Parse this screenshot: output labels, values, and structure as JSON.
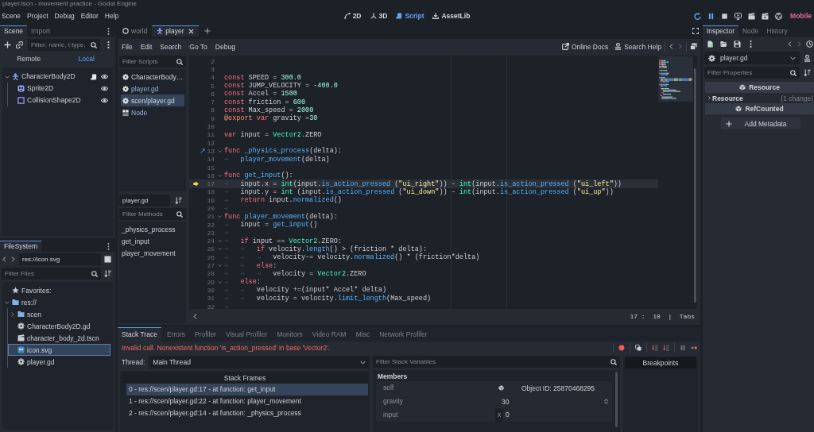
{
  "window": {
    "title": "player.tscn - movement practice - Godot Engine"
  },
  "menu": [
    "Scene",
    "Project",
    "Debug",
    "Editor",
    "Help"
  ],
  "workspaces": [
    {
      "label": "2D",
      "kind": "canvas",
      "selected": false
    },
    {
      "label": "3D",
      "kind": "spatial",
      "selected": false
    },
    {
      "label": "Script",
      "kind": "script",
      "selected": true
    },
    {
      "label": "AssetLib",
      "kind": "assetlib",
      "selected": false
    }
  ],
  "run_buttons": [
    {
      "kind": "restart",
      "active": true
    },
    {
      "kind": "pause",
      "active": true
    },
    {
      "kind": "stop",
      "active": false
    },
    {
      "kind": "remote",
      "active": false
    },
    {
      "kind": "playscene",
      "active": false
    },
    {
      "kind": "playcustom",
      "active": false
    },
    {
      "kind": "movie",
      "active": false
    }
  ],
  "renderer": "Mobile",
  "scene_dock": {
    "tabs": [
      {
        "label": "Scene",
        "selected": true
      },
      {
        "label": "Import",
        "selected": false
      }
    ],
    "filter": {
      "placeholder": "Filter: name, t:type,"
    },
    "modes": [
      {
        "label": "Remote",
        "selected": false
      },
      {
        "label": "Local",
        "selected": true
      }
    ],
    "tree": [
      {
        "name": "CharacterBody2D",
        "kind": "body",
        "expanded": true,
        "script": true,
        "visible": true,
        "children": [
          {
            "name": "Sprite2D",
            "kind": "sprite",
            "script": false,
            "visible": true
          },
          {
            "name": "CollisionShape2D",
            "kind": "shape",
            "script": false,
            "visible": true
          }
        ]
      }
    ]
  },
  "filesystem": {
    "tab": "FileSystem",
    "path": "res://icon.svg",
    "filter": {
      "placeholder": "Filter Files"
    },
    "tree": [
      {
        "name": "Favorites:",
        "kind": "favorites",
        "selected": false
      },
      {
        "name": "res://",
        "kind": "folder",
        "expanded": true,
        "selected": false,
        "children": [
          {
            "name": "scen",
            "kind": "folder",
            "expanded": false,
            "selected": false
          },
          {
            "name": "CharacterBody2D.gd",
            "kind": "script",
            "selected": false
          },
          {
            "name": "character_body_2d.tscn",
            "kind": "scene",
            "selected": false
          },
          {
            "name": "icon.svg",
            "kind": "image",
            "selected": true
          },
          {
            "name": "player.gd",
            "kind": "script",
            "selected": false
          }
        ]
      }
    ]
  },
  "scene_tabs": [
    {
      "label": "world",
      "kind": "node",
      "selected": false,
      "closable": false
    },
    {
      "label": "player",
      "kind": "body",
      "selected": true,
      "closable": true
    }
  ],
  "script_editor": {
    "menu": [
      "File",
      "Edit",
      "Search",
      "Go To",
      "Debug"
    ],
    "links": [
      {
        "label": "Online Docs",
        "kind": "docs"
      },
      {
        "label": "Search Help",
        "kind": "help"
      }
    ],
    "scripts_filter": {
      "placeholder": "Filter Scripts"
    },
    "scripts": [
      {
        "name": "CharacterBody…",
        "kind": "script",
        "highlighted": false,
        "selected": false
      },
      {
        "name": "player.gd",
        "kind": "script",
        "highlighted": true,
        "selected": false
      },
      {
        "name": "scen/player.gd",
        "kind": "script",
        "highlighted": false,
        "selected": true
      },
      {
        "name": "Node",
        "kind": "doc",
        "highlighted": true,
        "selected": false
      }
    ],
    "current_script": "player.gd",
    "methods_filter": {
      "placeholder": "Filter Methods"
    },
    "methods": [
      {
        "name": "_physics_process",
        "selected": false
      },
      {
        "name": "get_input",
        "selected": false
      },
      {
        "name": "player_movement",
        "selected": false
      }
    ],
    "code": [
      {
        "number": "2",
        "foldable": false,
        "current": false,
        "overrides": false
      },
      {
        "number": "3",
        "foldable": false,
        "current": false,
        "overrides": false
      },
      {
        "number": "4",
        "foldable": false,
        "current": false,
        "overrides": false,
        "tokens": [
          {
            "kind": "keyword",
            "text": "const"
          },
          {
            "kind": "plain",
            "text": " SPEED = "
          },
          {
            "kind": "number",
            "text": "300.0"
          }
        ]
      },
      {
        "number": "5",
        "foldable": false,
        "current": false,
        "overrides": false,
        "tokens": [
          {
            "kind": "keyword",
            "text": "const"
          },
          {
            "kind": "plain",
            "text": " JUMP_VELOCITY = "
          },
          {
            "kind": "number",
            "text": "-400.0"
          }
        ]
      },
      {
        "number": "6",
        "foldable": false,
        "current": false,
        "overrides": false,
        "tokens": [
          {
            "kind": "keyword",
            "text": "const"
          },
          {
            "kind": "plain",
            "text": " Accel = "
          },
          {
            "kind": "number",
            "text": "1500"
          }
        ]
      },
      {
        "number": "7",
        "foldable": false,
        "current": false,
        "overrides": false,
        "tokens": [
          {
            "kind": "keyword",
            "text": "const"
          },
          {
            "kind": "plain",
            "text": " friction = "
          },
          {
            "kind": "number",
            "text": "600"
          }
        ]
      },
      {
        "number": "8",
        "foldable": false,
        "current": false,
        "overrides": false,
        "tokens": [
          {
            "kind": "keyword",
            "text": "const"
          },
          {
            "kind": "plain",
            "text": " Max_speed = "
          },
          {
            "kind": "number",
            "text": "2000"
          }
        ]
      },
      {
        "number": "9",
        "foldable": false,
        "current": false,
        "overrides": false,
        "tokens": [
          {
            "kind": "annotation",
            "text": "@export"
          },
          {
            "kind": "keyword",
            "text": " var"
          },
          {
            "kind": "plain",
            "text": " gravity ="
          },
          {
            "kind": "number",
            "text": "30"
          }
        ]
      },
      {
        "number": "10",
        "foldable": false,
        "current": false,
        "overrides": false
      },
      {
        "number": "11",
        "foldable": false,
        "current": false,
        "overrides": false,
        "tokens": [
          {
            "kind": "keyword",
            "text": "var"
          },
          {
            "kind": "plain",
            "text": " input = "
          },
          {
            "kind": "type",
            "text": "Vector2"
          },
          {
            "kind": "plain",
            "text": ".ZERO"
          }
        ]
      },
      {
        "number": "12",
        "foldable": false,
        "current": false,
        "overrides": false
      },
      {
        "number": "13",
        "foldable": true,
        "current": false,
        "overrides": true,
        "tokens": [
          {
            "kind": "keyword",
            "text": "func"
          },
          {
            "kind": "function",
            "text": " _physics_process"
          },
          {
            "kind": "plain",
            "text": "(delta):"
          }
        ]
      },
      {
        "number": "14",
        "foldable": false,
        "current": false,
        "overrides": false,
        "tokens": [
          {
            "kind": "tab"
          },
          {
            "kind": "function",
            "text": "player_movement"
          },
          {
            "kind": "plain",
            "text": "(delta)"
          }
        ]
      },
      {
        "number": "15",
        "foldable": false,
        "current": false,
        "overrides": false
      },
      {
        "number": "16",
        "foldable": true,
        "current": false,
        "overrides": false,
        "tokens": [
          {
            "kind": "keyword",
            "text": "func"
          },
          {
            "kind": "function",
            "text": " get_input"
          },
          {
            "kind": "plain",
            "text": "():"
          }
        ]
      },
      {
        "number": "17",
        "foldable": false,
        "current": true,
        "overrides": false,
        "tokens": [
          {
            "kind": "tab"
          },
          {
            "kind": "plain",
            "text": "input.x = "
          },
          {
            "kind": "type",
            "text": "int"
          },
          {
            "kind": "plain",
            "text": "(input."
          },
          {
            "kind": "function",
            "text": "is_action_pressed"
          },
          {
            "kind": "plain",
            "text": " ("
          },
          {
            "kind": "string",
            "text": "\"ui_right\""
          },
          {
            "kind": "plain",
            "text": ")) - "
          },
          {
            "kind": "type",
            "text": "int"
          },
          {
            "kind": "plain",
            "text": "(input."
          },
          {
            "kind": "function",
            "text": "is_action_pressed"
          },
          {
            "kind": "plain",
            "text": " ("
          },
          {
            "kind": "string",
            "text": "\"ui_left\""
          },
          {
            "kind": "plain",
            "text": "))"
          }
        ]
      },
      {
        "number": "18",
        "foldable": false,
        "current": false,
        "overrides": false,
        "tokens": [
          {
            "kind": "tab"
          },
          {
            "kind": "plain",
            "text": "input.y = "
          },
          {
            "kind": "type",
            "text": "int"
          },
          {
            "kind": "plain",
            "text": " (input."
          },
          {
            "kind": "function",
            "text": "is_action_pressed"
          },
          {
            "kind": "plain",
            "text": " ("
          },
          {
            "kind": "string",
            "text": "\"ui_down\""
          },
          {
            "kind": "plain",
            "text": ")) - "
          },
          {
            "kind": "type",
            "text": "int"
          },
          {
            "kind": "plain",
            "text": "(input."
          },
          {
            "kind": "function",
            "text": "is_action_pressed"
          },
          {
            "kind": "plain",
            "text": " ("
          },
          {
            "kind": "string",
            "text": "\"ui_up\""
          },
          {
            "kind": "plain",
            "text": "))"
          }
        ]
      },
      {
        "number": "19",
        "foldable": false,
        "current": false,
        "overrides": false,
        "tokens": [
          {
            "kind": "tab"
          },
          {
            "kind": "keyword",
            "text": "return"
          },
          {
            "kind": "plain",
            "text": " input."
          },
          {
            "kind": "function",
            "text": "normalized"
          },
          {
            "kind": "plain",
            "text": "()"
          }
        ]
      },
      {
        "number": "20",
        "foldable": false,
        "current": false,
        "overrides": false,
        "tokens": [
          {
            "kind": "tab"
          }
        ]
      },
      {
        "number": "21",
        "foldable": true,
        "current": false,
        "overrides": false,
        "tokens": [
          {
            "kind": "keyword",
            "text": "func"
          },
          {
            "kind": "function",
            "text": " player_movement"
          },
          {
            "kind": "plain",
            "text": "(delta):"
          }
        ]
      },
      {
        "number": "22",
        "foldable": false,
        "current": false,
        "overrides": false,
        "tokens": [
          {
            "kind": "tab"
          },
          {
            "kind": "plain",
            "text": "input = "
          },
          {
            "kind": "function",
            "text": "get_input"
          },
          {
            "kind": "plain",
            "text": "()"
          }
        ]
      },
      {
        "number": "23",
        "foldable": false,
        "current": false,
        "overrides": false,
        "tokens": [
          {
            "kind": "tab"
          }
        ]
      },
      {
        "number": "24",
        "foldable": true,
        "current": false,
        "overrides": false,
        "tokens": [
          {
            "kind": "tab"
          },
          {
            "kind": "keyword",
            "text": "if"
          },
          {
            "kind": "plain",
            "text": " input == "
          },
          {
            "kind": "type",
            "text": "Vector2"
          },
          {
            "kind": "plain",
            "text": ".ZERO:"
          }
        ]
      },
      {
        "number": "25",
        "foldable": true,
        "current": false,
        "overrides": false,
        "tokens": [
          {
            "kind": "tab"
          },
          {
            "kind": "tab"
          },
          {
            "kind": "keyword",
            "text": "if"
          },
          {
            "kind": "plain",
            "text": " velocity."
          },
          {
            "kind": "function",
            "text": "length"
          },
          {
            "kind": "plain",
            "text": "() > (friction * delta):"
          }
        ]
      },
      {
        "number": "26",
        "foldable": false,
        "current": false,
        "overrides": false,
        "tokens": [
          {
            "kind": "tab"
          },
          {
            "kind": "tab"
          },
          {
            "kind": "tab"
          },
          {
            "kind": "plain",
            "text": "velocity-= velocity."
          },
          {
            "kind": "function",
            "text": "normalized"
          },
          {
            "kind": "plain",
            "text": "() * (friction*delta)"
          }
        ]
      },
      {
        "number": "27",
        "foldable": true,
        "current": false,
        "overrides": false,
        "tokens": [
          {
            "kind": "tab"
          },
          {
            "kind": "tab"
          },
          {
            "kind": "keyword",
            "text": "else"
          },
          {
            "kind": "plain",
            "text": ":"
          }
        ]
      },
      {
        "number": "28",
        "foldable": false,
        "current": false,
        "overrides": false,
        "tokens": [
          {
            "kind": "tab"
          },
          {
            "kind": "tab"
          },
          {
            "kind": "tab"
          },
          {
            "kind": "plain",
            "text": "velocity = "
          },
          {
            "kind": "type",
            "text": "Vector2"
          },
          {
            "kind": "plain",
            "text": ".ZERO"
          }
        ]
      },
      {
        "number": "29",
        "foldable": true,
        "current": false,
        "overrides": false,
        "tokens": [
          {
            "kind": "tab"
          },
          {
            "kind": "keyword",
            "text": "else"
          },
          {
            "kind": "plain",
            "text": ":"
          }
        ]
      },
      {
        "number": "30",
        "foldable": false,
        "current": false,
        "overrides": false,
        "tokens": [
          {
            "kind": "tab"
          },
          {
            "kind": "tab"
          },
          {
            "kind": "plain",
            "text": "velocity +=(input* Accel* delta)"
          }
        ]
      },
      {
        "number": "31",
        "foldable": false,
        "current": false,
        "overrides": false,
        "tokens": [
          {
            "kind": "tab"
          },
          {
            "kind": "tab"
          },
          {
            "kind": "plain",
            "text": "velocity = velocity."
          },
          {
            "kind": "function",
            "text": "limit_length"
          },
          {
            "kind": "plain",
            "text": "(Max_speed)"
          }
        ]
      },
      {
        "number": "32",
        "foldable": false,
        "current": false,
        "overrides": false,
        "tokens": [
          {
            "kind": "tab"
          }
        ]
      }
    ],
    "status": "17 :  10  |  Tabs"
  },
  "debugger": {
    "tabs": [
      {
        "label": "Stack Trace",
        "selected": true
      },
      {
        "label": "Errors",
        "selected": false
      },
      {
        "label": "Profiler",
        "selected": false
      },
      {
        "label": "Visual Profiler",
        "selected": false
      },
      {
        "label": "Monitors",
        "selected": false
      },
      {
        "label": "Video RAM",
        "selected": false
      },
      {
        "label": "Misc",
        "selected": false
      },
      {
        "label": "Network Profiler",
        "selected": false
      }
    ],
    "error": "Invalid call. Nonexistent function 'is_action_pressed' in base 'Vector2'.",
    "thread_label": "Thread:",
    "thread": "Main Thread",
    "frames_header": "Stack Frames",
    "frames": [
      {
        "text": "0 - res://scen/player.gd:17 - at function: get_input",
        "selected": true
      },
      {
        "text": "1 - res://scen/player.gd:22 - at function: player_movement",
        "selected": false
      },
      {
        "text": "2 - res://scen/player.gd:14 - at function: _physics_process",
        "selected": false
      }
    ],
    "variables_filter": {
      "placeholder": "Filter Stack Variables"
    },
    "members_header": "Members",
    "members": [
      {
        "name": "self",
        "kind": "object",
        "value": "Object ID: 25870468295"
      },
      {
        "name": "gravity",
        "kind": "number",
        "value": "30"
      },
      {
        "name": "input",
        "kind": "vector",
        "axis": "x",
        "value": "0"
      }
    ],
    "breakpoints_header": "Breakpoints"
  },
  "inspector": {
    "tabs": [
      {
        "label": "Inspector",
        "selected": true
      },
      {
        "label": "Node",
        "selected": false
      },
      {
        "label": "History",
        "selected": false
      }
    ],
    "resource": "player.gd",
    "filter": {
      "placeholder": "Filter Properties"
    },
    "sections": [
      {
        "kind": "category",
        "label": "Resource"
      },
      {
        "kind": "group",
        "label": "Resource",
        "note": "(1 change)",
        "expanded": false
      },
      {
        "kind": "category",
        "label": "RefCounted"
      }
    ],
    "add_metadata": "Add Metadata"
  }
}
